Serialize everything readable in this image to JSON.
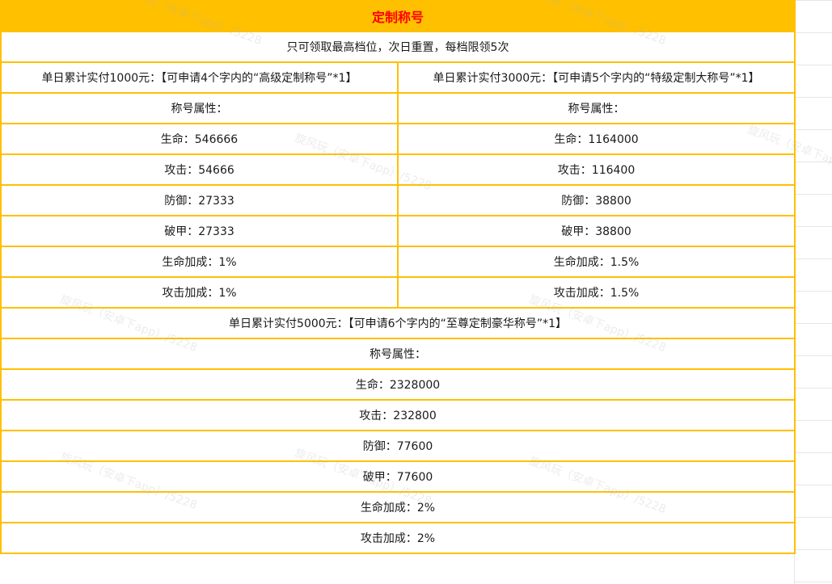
{
  "title": "定制称号",
  "rule": "只可领取最高档位，次日重置，每档限领5次",
  "tier1": {
    "header": "单日累计实付1000元：【可申请4个字内的“高级定制称号”*1】",
    "attr_label": "称号属性：",
    "stats": [
      "生命：546666",
      "攻击：54666",
      "防御：27333",
      "破甲：27333",
      "生命加成：1%",
      "攻击加成：1%"
    ]
  },
  "tier2": {
    "header": "单日累计实付3000元：【可申请5个字内的“特级定制大称号”*1】",
    "attr_label": "称号属性：",
    "stats": [
      "生命：1164000",
      "攻击：116400",
      "防御：38800",
      "破甲：38800",
      "生命加成：1.5%",
      "攻击加成：1.5%"
    ]
  },
  "tier3": {
    "header": "单日累计实付5000元：【可申请6个字内的“至尊定制豪华称号”*1】",
    "attr_label": "称号属性：",
    "stats": [
      "生命：2328000",
      "攻击：232800",
      "防御：77600",
      "破甲：77600",
      "生命加成：2%",
      "攻击加成：2%"
    ]
  },
  "watermark_text": "旋风玩（安卓下app）/5228"
}
